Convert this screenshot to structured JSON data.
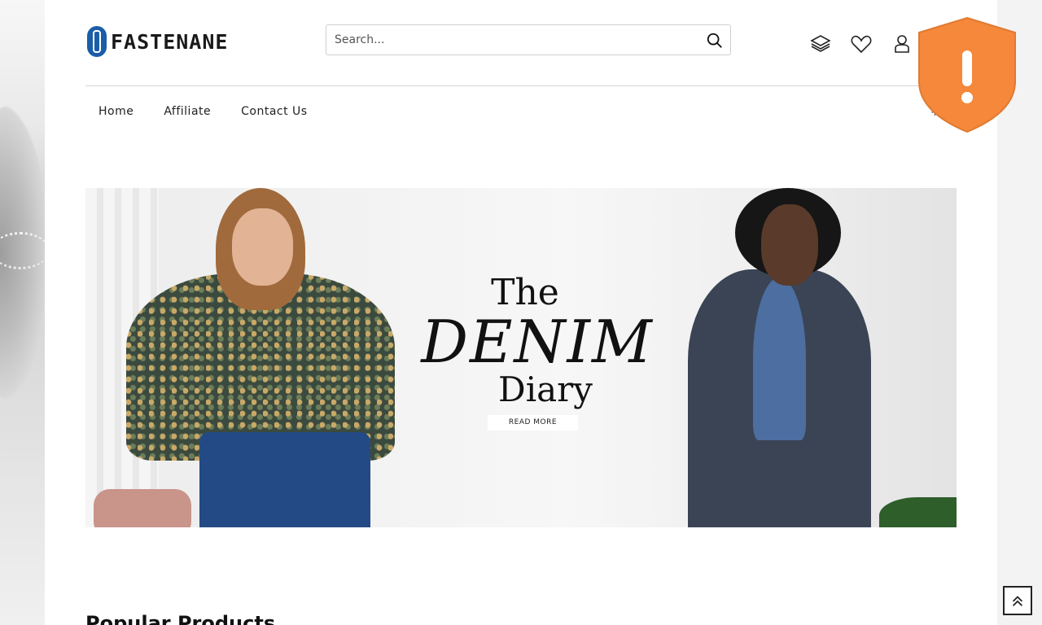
{
  "brand": {
    "name": "FASTENANE",
    "logo_color": "#1a5ea8"
  },
  "search": {
    "placeholder": "Search...",
    "button_icon": "search-icon"
  },
  "header_icons": [
    "layers-icon",
    "heart-icon",
    "user-icon"
  ],
  "nav": {
    "items": [
      "Home",
      "Affiliate",
      "Contact Us"
    ],
    "extra": "+"
  },
  "banner": {
    "heading_line1": "The",
    "heading_line2": "DENIM",
    "heading_line3": "Diary",
    "cta_label": "READ MORE"
  },
  "section": {
    "title": "Popular Products"
  },
  "overlay": {
    "shield_color": "#f5883a",
    "shield_symbol": "!"
  },
  "scroll_top_icon": "double-chevron-up-icon"
}
